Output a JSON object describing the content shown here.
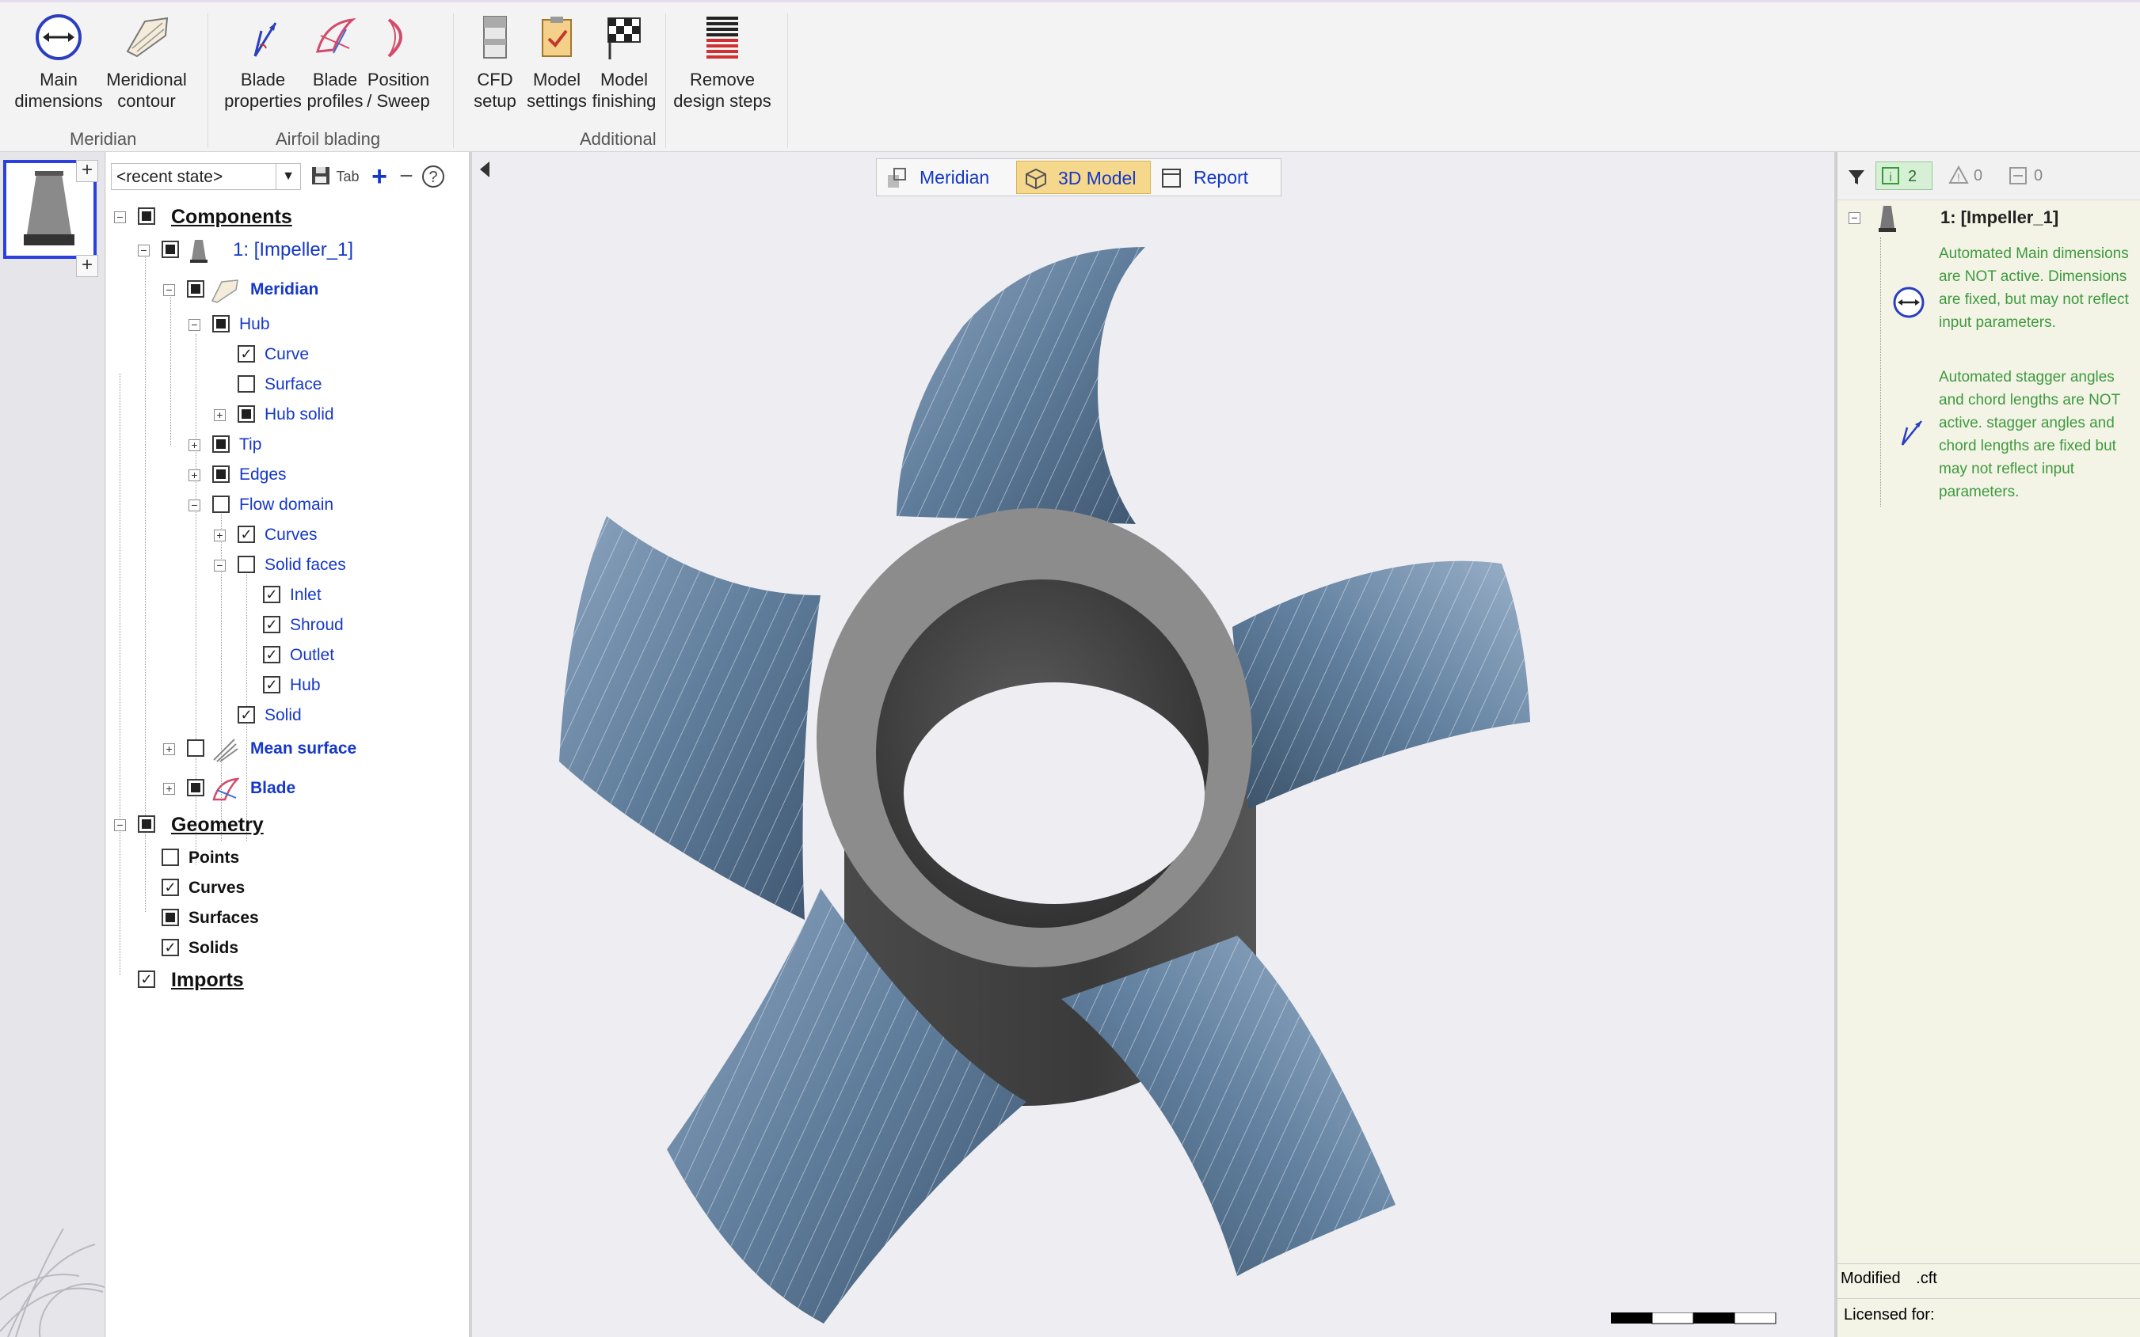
{
  "ribbon": {
    "buttons": [
      {
        "id": "main-dimensions",
        "label": "Main\ndimensions",
        "line1": "Main",
        "line2": "dimensions"
      },
      {
        "id": "meridional-contour",
        "line1": "Meridional",
        "line2": "contour"
      },
      {
        "id": "blade-properties",
        "line1": "Blade",
        "line2": "properties"
      },
      {
        "id": "blade-profiles",
        "line1": "Blade",
        "line2": "profiles"
      },
      {
        "id": "position-sweep",
        "line1": "Position",
        "line2": "/ Sweep"
      },
      {
        "id": "cfd-setup",
        "line1": "CFD",
        "line2": "setup"
      },
      {
        "id": "model-settings",
        "line1": "Model",
        "line2": "settings"
      },
      {
        "id": "model-finishing",
        "line1": "Model",
        "line2": "finishing"
      },
      {
        "id": "remove-design-steps",
        "line1": "Remove",
        "line2": "design steps"
      }
    ],
    "groups": {
      "meridian": "Meridian",
      "airfoil": "Airfoil blading",
      "additional": "Additional"
    }
  },
  "tree_toolbar": {
    "state_select": "<recent state>",
    "tab_icon": "Tab"
  },
  "tree": {
    "components": "Components",
    "impeller": "1: [Impeller_1]",
    "meridian": "Meridian",
    "hub": "Hub",
    "curve": "Curve",
    "surface": "Surface",
    "hub_solid": "Hub solid",
    "tip": "Tip",
    "edges": "Edges",
    "flow_domain": "Flow domain",
    "curves": "Curves",
    "solid_faces": "Solid faces",
    "inlet": "Inlet",
    "shroud": "Shroud",
    "outlet": "Outlet",
    "hub2": "Hub",
    "solid": "Solid",
    "mean_surface": "Mean surface",
    "blade": "Blade",
    "geometry": "Geometry",
    "points": "Points",
    "g_curves": "Curves",
    "surfaces": "Surfaces",
    "solids": "Solids",
    "imports": "Imports"
  },
  "view_tabs": {
    "meridian": "Meridian",
    "model3d": "3D Model",
    "report": "Report",
    "active": "3D Model"
  },
  "right_panel": {
    "info_count": "2",
    "warning_count": "0",
    "other_count": "0",
    "title": "1: [Impeller_1]",
    "msg1": "Automated Main dimensions are NOT active. Dimensions are fixed, but may not reflect input parameters.",
    "msg2": "Automated stagger angles and chord lengths are NOT active. stagger angles and chord lengths are fixed but may not reflect input parameters.",
    "status_modified": "Modified",
    "status_ext": ".cft",
    "licensed": "Licensed for:"
  },
  "colors": {
    "accent_blue": "#1538c8",
    "active_tab": "#f6d88c",
    "info_green": "#3e9a3e",
    "blade": "#5e7d9c",
    "hub": "#8c8c8c"
  }
}
